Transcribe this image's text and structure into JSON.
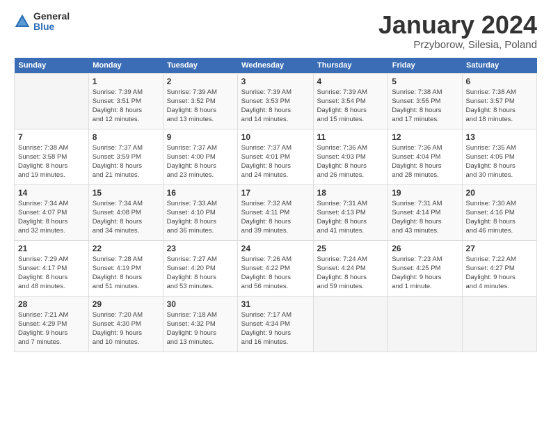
{
  "header": {
    "logo_general": "General",
    "logo_blue": "Blue",
    "month_title": "January 2024",
    "subtitle": "Przyborow, Silesia, Poland"
  },
  "calendar": {
    "days_of_week": [
      "Sunday",
      "Monday",
      "Tuesday",
      "Wednesday",
      "Thursday",
      "Friday",
      "Saturday"
    ],
    "weeks": [
      [
        {
          "day": "",
          "info": ""
        },
        {
          "day": "1",
          "info": "Sunrise: 7:39 AM\nSunset: 3:51 PM\nDaylight: 8 hours\nand 12 minutes."
        },
        {
          "day": "2",
          "info": "Sunrise: 7:39 AM\nSunset: 3:52 PM\nDaylight: 8 hours\nand 13 minutes."
        },
        {
          "day": "3",
          "info": "Sunrise: 7:39 AM\nSunset: 3:53 PM\nDaylight: 8 hours\nand 14 minutes."
        },
        {
          "day": "4",
          "info": "Sunrise: 7:39 AM\nSunset: 3:54 PM\nDaylight: 8 hours\nand 15 minutes."
        },
        {
          "day": "5",
          "info": "Sunrise: 7:38 AM\nSunset: 3:55 PM\nDaylight: 8 hours\nand 17 minutes."
        },
        {
          "day": "6",
          "info": "Sunrise: 7:38 AM\nSunset: 3:57 PM\nDaylight: 8 hours\nand 18 minutes."
        }
      ],
      [
        {
          "day": "7",
          "info": "Sunrise: 7:38 AM\nSunset: 3:58 PM\nDaylight: 8 hours\nand 19 minutes."
        },
        {
          "day": "8",
          "info": "Sunrise: 7:37 AM\nSunset: 3:59 PM\nDaylight: 8 hours\nand 21 minutes."
        },
        {
          "day": "9",
          "info": "Sunrise: 7:37 AM\nSunset: 4:00 PM\nDaylight: 8 hours\nand 23 minutes."
        },
        {
          "day": "10",
          "info": "Sunrise: 7:37 AM\nSunset: 4:01 PM\nDaylight: 8 hours\nand 24 minutes."
        },
        {
          "day": "11",
          "info": "Sunrise: 7:36 AM\nSunset: 4:03 PM\nDaylight: 8 hours\nand 26 minutes."
        },
        {
          "day": "12",
          "info": "Sunrise: 7:36 AM\nSunset: 4:04 PM\nDaylight: 8 hours\nand 28 minutes."
        },
        {
          "day": "13",
          "info": "Sunrise: 7:35 AM\nSunset: 4:05 PM\nDaylight: 8 hours\nand 30 minutes."
        }
      ],
      [
        {
          "day": "14",
          "info": "Sunrise: 7:34 AM\nSunset: 4:07 PM\nDaylight: 8 hours\nand 32 minutes."
        },
        {
          "day": "15",
          "info": "Sunrise: 7:34 AM\nSunset: 4:08 PM\nDaylight: 8 hours\nand 34 minutes."
        },
        {
          "day": "16",
          "info": "Sunrise: 7:33 AM\nSunset: 4:10 PM\nDaylight: 8 hours\nand 36 minutes."
        },
        {
          "day": "17",
          "info": "Sunrise: 7:32 AM\nSunset: 4:11 PM\nDaylight: 8 hours\nand 39 minutes."
        },
        {
          "day": "18",
          "info": "Sunrise: 7:31 AM\nSunset: 4:13 PM\nDaylight: 8 hours\nand 41 minutes."
        },
        {
          "day": "19",
          "info": "Sunrise: 7:31 AM\nSunset: 4:14 PM\nDaylight: 8 hours\nand 43 minutes."
        },
        {
          "day": "20",
          "info": "Sunrise: 7:30 AM\nSunset: 4:16 PM\nDaylight: 8 hours\nand 46 minutes."
        }
      ],
      [
        {
          "day": "21",
          "info": "Sunrise: 7:29 AM\nSunset: 4:17 PM\nDaylight: 8 hours\nand 48 minutes."
        },
        {
          "day": "22",
          "info": "Sunrise: 7:28 AM\nSunset: 4:19 PM\nDaylight: 8 hours\nand 51 minutes."
        },
        {
          "day": "23",
          "info": "Sunrise: 7:27 AM\nSunset: 4:20 PM\nDaylight: 8 hours\nand 53 minutes."
        },
        {
          "day": "24",
          "info": "Sunrise: 7:26 AM\nSunset: 4:22 PM\nDaylight: 8 hours\nand 56 minutes."
        },
        {
          "day": "25",
          "info": "Sunrise: 7:24 AM\nSunset: 4:24 PM\nDaylight: 8 hours\nand 59 minutes."
        },
        {
          "day": "26",
          "info": "Sunrise: 7:23 AM\nSunset: 4:25 PM\nDaylight: 9 hours\nand 1 minute."
        },
        {
          "day": "27",
          "info": "Sunrise: 7:22 AM\nSunset: 4:27 PM\nDaylight: 9 hours\nand 4 minutes."
        }
      ],
      [
        {
          "day": "28",
          "info": "Sunrise: 7:21 AM\nSunset: 4:29 PM\nDaylight: 9 hours\nand 7 minutes."
        },
        {
          "day": "29",
          "info": "Sunrise: 7:20 AM\nSunset: 4:30 PM\nDaylight: 9 hours\nand 10 minutes."
        },
        {
          "day": "30",
          "info": "Sunrise: 7:18 AM\nSunset: 4:32 PM\nDaylight: 9 hours\nand 13 minutes."
        },
        {
          "day": "31",
          "info": "Sunrise: 7:17 AM\nSunset: 4:34 PM\nDaylight: 9 hours\nand 16 minutes."
        },
        {
          "day": "",
          "info": ""
        },
        {
          "day": "",
          "info": ""
        },
        {
          "day": "",
          "info": ""
        }
      ]
    ]
  }
}
